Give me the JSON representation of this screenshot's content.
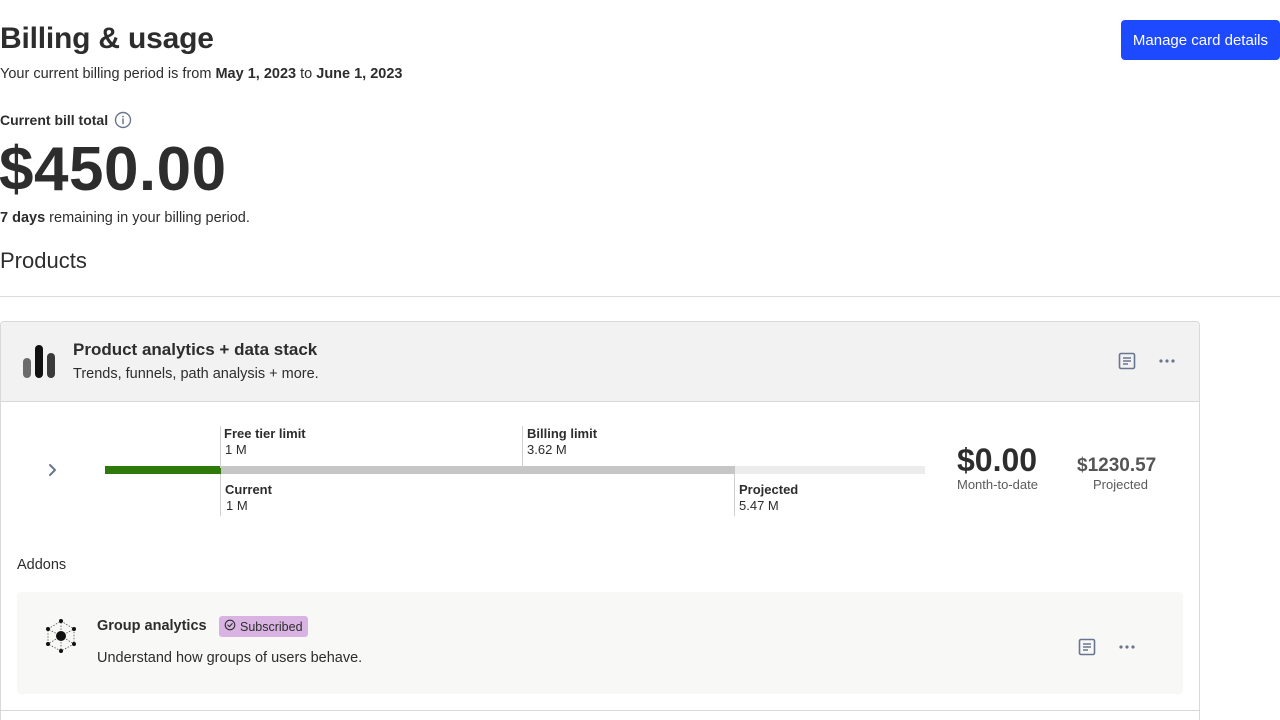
{
  "header": {
    "title": "Billing & usage",
    "period_prefix": "Your current billing period is from ",
    "period_start": "May 1, 2023",
    "period_mid": " to ",
    "period_end": "June 1, 2023",
    "manage_button": "Manage card details"
  },
  "bill": {
    "label": "Current bill total",
    "total": "$450.00",
    "days": "7 days",
    "days_suffix": " remaining in your billing period."
  },
  "products_heading": "Products",
  "product": {
    "title": "Product analytics + data stack",
    "subtitle": "Trends, funnels, path analysis + more.",
    "usage": {
      "free_tier_label": "Free tier limit",
      "free_tier_value": "1 M",
      "billing_limit_label": "Billing limit",
      "billing_limit_value": "3.62 M",
      "current_label": "Current",
      "current_value": "1 M",
      "projected_label": "Projected",
      "projected_value": "5.47 M"
    },
    "month_to_date_amount": "$0.00",
    "month_to_date_label": "Month-to-date",
    "projected_amount": "$1230.57",
    "projected_label": "Projected"
  },
  "addons": {
    "heading": "Addons",
    "items": [
      {
        "title": "Group analytics",
        "badge": "Subscribed",
        "subtitle": "Understand how groups of users behave."
      }
    ]
  },
  "colors": {
    "accent": "#1d4aff",
    "current_bar": "#2d7a0a",
    "projected_bar": "#c6c6c6",
    "badge": "#d9b4e3"
  },
  "icons": [
    "info-icon",
    "bar-chart-icon",
    "document-icon",
    "more-icon",
    "chevron-right-icon",
    "group-analytics-icon",
    "check-circle-icon"
  ]
}
